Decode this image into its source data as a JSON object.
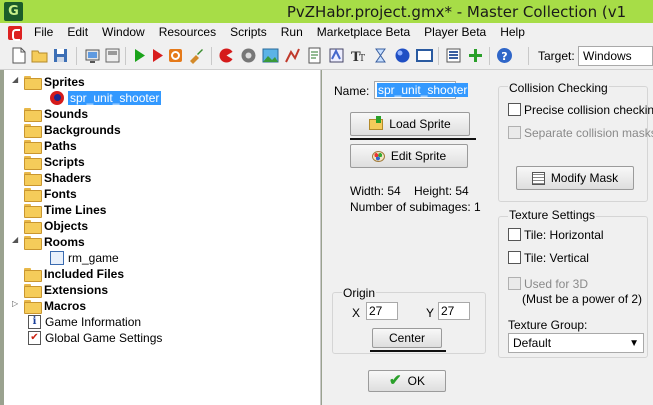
{
  "window": {
    "title": "PvZHabr.project.gmx*  -  Master Collection (v1"
  },
  "menu": {
    "items": [
      "File",
      "Edit",
      "Window",
      "Resources",
      "Scripts",
      "Run",
      "Marketplace Beta",
      "Player Beta",
      "Help"
    ]
  },
  "toolbar": {
    "target_label": "Target:",
    "target_value": "Windows"
  },
  "tree": {
    "items": [
      {
        "label": "Sprites",
        "bold": true
      },
      {
        "label": "spr_unit_shooter",
        "selected": true
      },
      {
        "label": "Sounds",
        "bold": true
      },
      {
        "label": "Backgrounds",
        "bold": true
      },
      {
        "label": "Paths",
        "bold": true
      },
      {
        "label": "Scripts",
        "bold": true
      },
      {
        "label": "Shaders",
        "bold": true
      },
      {
        "label": "Fonts",
        "bold": true
      },
      {
        "label": "Time Lines",
        "bold": true
      },
      {
        "label": "Objects",
        "bold": true
      },
      {
        "label": "Rooms",
        "bold": true
      },
      {
        "label": "rm_game"
      },
      {
        "label": "Included Files",
        "bold": true
      },
      {
        "label": "Extensions",
        "bold": true
      },
      {
        "label": "Macros",
        "bold": true
      },
      {
        "label": "Game Information"
      },
      {
        "label": "Global Game Settings"
      }
    ]
  },
  "sprite": {
    "name_label": "Name:",
    "name_value": "spr_unit_shooter",
    "load_button": "Load Sprite",
    "edit_button": "Edit Sprite",
    "width_text": "Width: 54",
    "height_text": "Height: 54",
    "subimages_text": "Number of subimages: 1",
    "origin_label": "Origin",
    "x_label": "X",
    "x_value": "27",
    "y_label": "Y",
    "y_value": "27",
    "center_button": "Center",
    "ok_button": "OK"
  },
  "collision": {
    "title": "Collision Checking",
    "precise": "Precise collision checking",
    "separate": "Separate collision masks",
    "modify_mask": "Modify Mask"
  },
  "texture": {
    "title": "Texture Settings",
    "tile_h": "Tile: Horizontal",
    "tile_v": "Tile: Vertical",
    "used_3d": "Used for 3D",
    "power_note": "(Must be a power of 2)",
    "group_label": "Texture Group:",
    "group_value": "Default"
  }
}
